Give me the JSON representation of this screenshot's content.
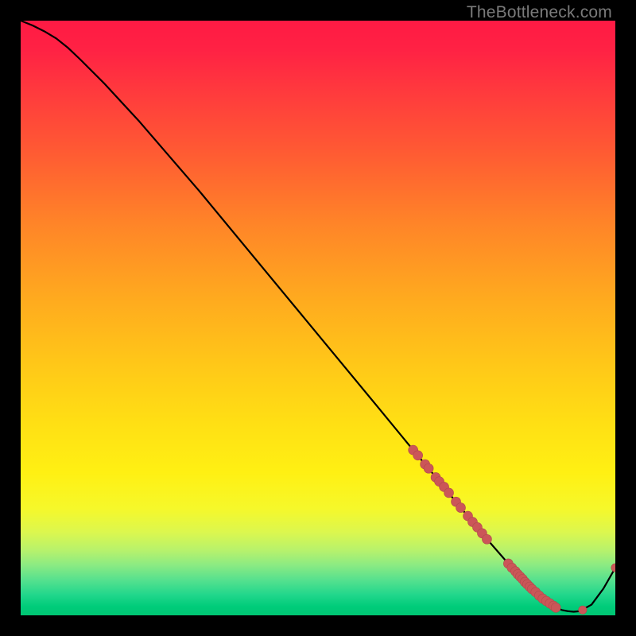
{
  "attribution": "TheBottleneck.com",
  "palette": {
    "bg": "#000000",
    "curve": "#000000",
    "marker_fill": "#cb5658",
    "marker_stroke": "#b04a4c"
  },
  "gradient_stops": [
    {
      "offset": 0.0,
      "color": "#ff1a44"
    },
    {
      "offset": 0.05,
      "color": "#ff2244"
    },
    {
      "offset": 0.12,
      "color": "#ff3a3d"
    },
    {
      "offset": 0.22,
      "color": "#ff5a33"
    },
    {
      "offset": 0.34,
      "color": "#ff8428"
    },
    {
      "offset": 0.46,
      "color": "#ffa81f"
    },
    {
      "offset": 0.58,
      "color": "#ffc818"
    },
    {
      "offset": 0.68,
      "color": "#ffe014"
    },
    {
      "offset": 0.76,
      "color": "#fff013"
    },
    {
      "offset": 0.82,
      "color": "#f6f82a"
    },
    {
      "offset": 0.86,
      "color": "#dcf74e"
    },
    {
      "offset": 0.89,
      "color": "#b8f26b"
    },
    {
      "offset": 0.915,
      "color": "#8ceb82"
    },
    {
      "offset": 0.94,
      "color": "#57e18e"
    },
    {
      "offset": 0.965,
      "color": "#22d78c"
    },
    {
      "offset": 0.985,
      "color": "#00cc7a"
    },
    {
      "offset": 1.0,
      "color": "#00c673"
    }
  ],
  "chart_data": {
    "type": "line",
    "title": "",
    "xlabel": "",
    "ylabel": "",
    "xlim": [
      0,
      100
    ],
    "ylim": [
      0,
      100
    ],
    "series": [
      {
        "name": "bottleneck-curve",
        "x": [
          0,
          2,
          4,
          6,
          8,
          10,
          14,
          20,
          30,
          40,
          50,
          60,
          66,
          70,
          74,
          78,
          80,
          82,
          84,
          86,
          88,
          90,
          91,
          92,
          93,
          94,
          96,
          98,
          100
        ],
        "y": [
          100,
          99.2,
          98.2,
          97.0,
          95.4,
          93.5,
          89.5,
          83.0,
          71.4,
          59.3,
          47.2,
          35.1,
          27.8,
          23.0,
          18.1,
          13.3,
          11.0,
          8.7,
          6.5,
          4.4,
          2.6,
          1.3,
          0.9,
          0.7,
          0.6,
          0.7,
          1.8,
          4.5,
          8.0
        ]
      }
    ],
    "markers": [
      {
        "name": "cluster-descent",
        "points": [
          {
            "x": 66.0,
            "y": 27.8
          },
          {
            "x": 66.8,
            "y": 26.9
          },
          {
            "x": 68.0,
            "y": 25.4
          },
          {
            "x": 68.6,
            "y": 24.7
          },
          {
            "x": 69.8,
            "y": 23.2
          },
          {
            "x": 70.4,
            "y": 22.5
          },
          {
            "x": 71.2,
            "y": 21.6
          },
          {
            "x": 72.0,
            "y": 20.6
          },
          {
            "x": 73.2,
            "y": 19.1
          },
          {
            "x": 74.0,
            "y": 18.1
          },
          {
            "x": 75.2,
            "y": 16.7
          },
          {
            "x": 76.0,
            "y": 15.7
          },
          {
            "x": 76.8,
            "y": 14.8
          },
          {
            "x": 77.6,
            "y": 13.8
          },
          {
            "x": 78.4,
            "y": 12.8
          }
        ]
      },
      {
        "name": "cluster-valley",
        "points": [
          {
            "x": 82.0,
            "y": 8.7
          },
          {
            "x": 82.6,
            "y": 8.0
          },
          {
            "x": 83.2,
            "y": 7.4
          },
          {
            "x": 83.6,
            "y": 6.9
          },
          {
            "x": 84.0,
            "y": 6.5
          },
          {
            "x": 84.4,
            "y": 6.1
          },
          {
            "x": 84.8,
            "y": 5.6
          },
          {
            "x": 85.2,
            "y": 5.2
          },
          {
            "x": 85.6,
            "y": 4.8
          },
          {
            "x": 86.0,
            "y": 4.4
          },
          {
            "x": 86.6,
            "y": 3.9
          },
          {
            "x": 87.2,
            "y": 3.3
          },
          {
            "x": 87.8,
            "y": 2.8
          },
          {
            "x": 88.4,
            "y": 2.4
          },
          {
            "x": 89.0,
            "y": 2.0
          },
          {
            "x": 89.6,
            "y": 1.6
          },
          {
            "x": 90.0,
            "y": 1.3
          }
        ]
      },
      {
        "name": "cluster-tail",
        "points": [
          {
            "x": 94.5,
            "y": 0.9
          },
          {
            "x": 100.0,
            "y": 8.0
          }
        ]
      }
    ]
  }
}
